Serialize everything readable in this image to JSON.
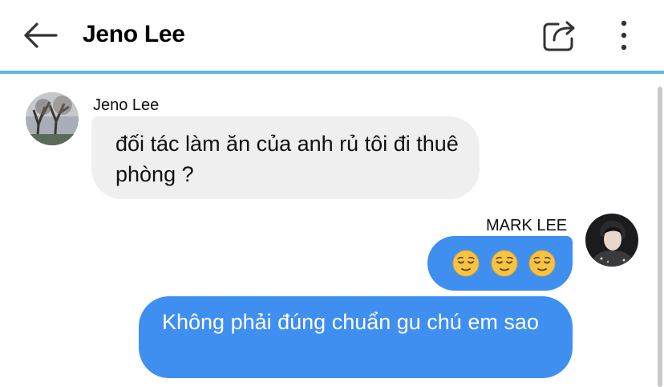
{
  "header": {
    "title": "Jeno Lee",
    "back_icon": "arrow-left-icon",
    "share_icon": "share-icon",
    "more_icon": "more-vertical-icon"
  },
  "colors": {
    "accent_line": "#5db8ea",
    "outgoing_bubble": "#3e8ff0",
    "incoming_bubble": "#efefef"
  },
  "messages": [
    {
      "sender": "Jeno Lee",
      "side": "left",
      "avatar": "avatar-photo-trees",
      "text": "đối tác làm ăn của anh rủ tôi đi thuê phòng ?"
    },
    {
      "sender": "MARK LEE",
      "side": "right",
      "avatar": "avatar-photo-person",
      "emojis": [
        "relieved-face-icon",
        "relieved-face-icon",
        "relieved-face-icon"
      ]
    },
    {
      "side": "right",
      "text": "Không phải đúng chuẩn gu chú em sao"
    }
  ]
}
